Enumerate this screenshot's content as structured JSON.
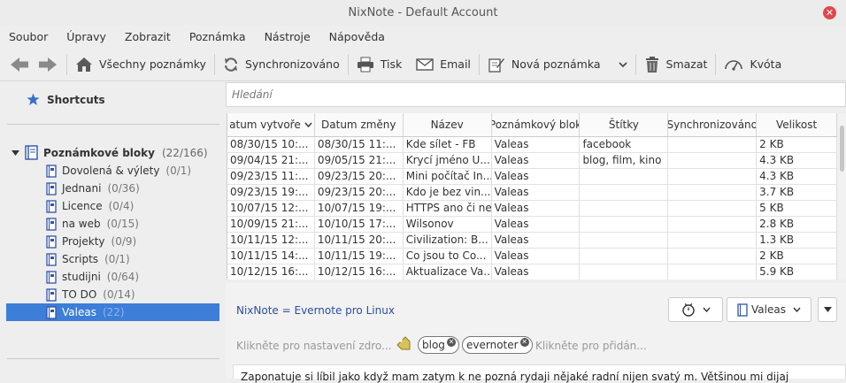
{
  "window": {
    "title": "NixNote - Default Account",
    "close_glyph": "✕"
  },
  "menu": [
    "Soubor",
    "Úpravy",
    "Zobrazit",
    "Poznámka",
    "Nástroje",
    "Nápověda"
  ],
  "toolbar": {
    "all_notes": "Všechny poznámky",
    "sync": "Synchronizováno",
    "print": "Tisk",
    "email": "Email",
    "new_note": "Nová poznámka",
    "delete": "Smazat",
    "quota": "Kvóta"
  },
  "sidebar": {
    "shortcuts": "Shortcuts",
    "notebooks_label": "Poznámkové bloky",
    "notebooks_count": "(22/166)",
    "notebooks": [
      {
        "name": "Dovolená & výlety",
        "count": "(0/1)"
      },
      {
        "name": "Jednani",
        "count": "(0/36)"
      },
      {
        "name": "Licence",
        "count": "(0/4)"
      },
      {
        "name": "na web",
        "count": "(0/15)"
      },
      {
        "name": "Projekty",
        "count": "(0/9)"
      },
      {
        "name": "Scripts",
        "count": "(0/1)"
      },
      {
        "name": "studijni",
        "count": "(0/64)"
      },
      {
        "name": "TO DO",
        "count": "(0/14)"
      },
      {
        "name": "Valeas",
        "count": "(22)"
      }
    ]
  },
  "search": {
    "placeholder": "Hledání"
  },
  "table": {
    "columns": [
      "atum vytvoře",
      "Datum změny",
      "Název",
      "Poznámkový blok",
      "Štítky",
      "Synchronizováno",
      "Velikost"
    ],
    "rows": [
      [
        "08/30/15 10:...",
        "08/30/15 11:...",
        "Kde sílet - FB",
        "Valeas",
        "facebook",
        "",
        "2 KB"
      ],
      [
        "09/04/15 21:...",
        "09/05/15 21:...",
        "Krycí jméno U...",
        "Valeas",
        "blog, film, kino",
        "",
        "4.3 KB"
      ],
      [
        "09/23/15 11:...",
        "09/23/15 20:...",
        "Mini počítač In...",
        "Valeas",
        "",
        "",
        "4.3 KB"
      ],
      [
        "09/23/15 19:...",
        "09/23/15 20:...",
        "Kdo je bez vin...",
        "Valeas",
        "",
        "",
        "3.7 KB"
      ],
      [
        "10/07/15 12:...",
        "10/07/15 19:...",
        "HTTPS ano či ne",
        "Valeas",
        "",
        "",
        "5 KB"
      ],
      [
        "10/09/15 21:...",
        "10/10/15 17:...",
        "Wilsonov",
        "Valeas",
        "",
        "",
        "2.8 KB"
      ],
      [
        "10/11/15 12:...",
        "10/11/15 20:...",
        "Civilization: B...",
        "Valeas",
        "",
        "",
        "1.3 KB"
      ],
      [
        "10/11/15 14:...",
        "10/11/15 19:...",
        "Co jsou to Co...",
        "Valeas",
        "",
        "",
        "2 KB"
      ],
      [
        "10/12/15 16:...",
        "10/12/15 16:...",
        "Aktualizace Va...",
        "Valeas",
        "",
        "",
        "5.9 KB"
      ]
    ]
  },
  "editor": {
    "title": "NixNote = Evernote pro Linux",
    "notebook": "Valeas",
    "source_placeholder": "Klikněte pro nastavení zdro...",
    "tags": [
      "blog",
      "evernoter"
    ],
    "add_tag_placeholder": "Klikněte pro přidán...",
    "body_preview": "Zaponatuje si líbil jako když mam zatym k ne pozná rydaji nějaké radní nijen svatý m. Většinou mi dijaj"
  }
}
